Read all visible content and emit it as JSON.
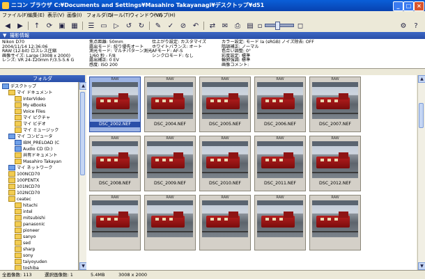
{
  "window": {
    "title": "ニコン ブラウザ C:¥Documents and Settings¥Masahiro Takayanagi¥デスクトップ¥d51"
  },
  "menu": [
    "ファイル(F)",
    "編集(E)",
    "表示(V)",
    "画像(I)",
    "フォルダ(D)",
    "ツール(T)",
    "ウィンドウ(W)",
    "ヘルプ(H)"
  ],
  "info_panel": {
    "header": "撮影情報",
    "col1": [
      "Nikon D70",
      "2004/11/14 12:36:06",
      "RAW (12-bit) ロスレス圧縮",
      "画像サイズ: Large (3008 x 2000)",
      "レンズ: VR 24-120mm F/3.5-5.6 G"
    ],
    "col2": [
      "焦点距離: 50mm",
      "露出モード: 絞り優先オート",
      "測光モード: マルチパターン測光",
      "1/60 秒 - F/8",
      "露出補正: 0 EV",
      "感度: ISO 200"
    ],
    "col3": [
      "仕上がり設定: カスタマイズ",
      "ホワイトバランス: オート",
      "AFモード: AF-S",
      "シンクロモード: なし"
    ],
    "col4": [
      "カラー設定: モード Ia (sRGB)",
      "階調補正: ノーマル",
      "色合い調整: 0°",
      "彩度設定: 標準",
      "輪郭強調: 標準",
      "画像コメント:"
    ],
    "col5": [
      "ノイズ除去: OFF"
    ]
  },
  "folder_panel": {
    "header": "フォルダ",
    "items": [
      {
        "label": "デスクトップ",
        "indent": 0,
        "icon": "desktop-icon"
      },
      {
        "label": "マイ ドキュメント",
        "indent": 1,
        "icon": "folder-icon"
      },
      {
        "label": "InterVideo",
        "indent": 2,
        "icon": "folder-icon"
      },
      {
        "label": "My eBooks",
        "indent": 2,
        "icon": "folder-icon"
      },
      {
        "label": "Voice Files",
        "indent": 2,
        "icon": "folder-icon"
      },
      {
        "label": "マイ ピクチャ",
        "indent": 2,
        "icon": "folder-icon"
      },
      {
        "label": "マイ ビデオ",
        "indent": 2,
        "icon": "folder-icon"
      },
      {
        "label": "マイ ミュージック",
        "indent": 2,
        "icon": "folder-icon"
      },
      {
        "label": "マイ コンピュータ",
        "indent": 1,
        "icon": "computer-icon"
      },
      {
        "label": "IBM_PRELOAD (C",
        "indent": 2,
        "icon": "drive-icon"
      },
      {
        "label": "Audio CD (D:)",
        "indent": 2,
        "icon": "cd-icon"
      },
      {
        "label": "共有ドキュメント",
        "indent": 2,
        "icon": "folder-icon"
      },
      {
        "label": "Masahiro Takayan",
        "indent": 2,
        "icon": "folder-icon"
      },
      {
        "label": "マイ ネットワーク",
        "indent": 1,
        "icon": "network-icon"
      },
      {
        "label": "100NCD70",
        "indent": 1,
        "icon": "folder-icon"
      },
      {
        "label": "100PENTX",
        "indent": 1,
        "icon": "folder-icon"
      },
      {
        "label": "101NCD70",
        "indent": 1,
        "icon": "folder-icon"
      },
      {
        "label": "102NCD70",
        "indent": 1,
        "icon": "folder-icon"
      },
      {
        "label": "ceatec",
        "indent": 1,
        "icon": "folder-icon"
      },
      {
        "label": "hitachi",
        "indent": 2,
        "icon": "folder-icon"
      },
      {
        "label": "intel",
        "indent": 2,
        "icon": "folder-icon"
      },
      {
        "label": "mitsubishi",
        "indent": 2,
        "icon": "folder-icon"
      },
      {
        "label": "panasonic",
        "indent": 2,
        "icon": "folder-icon"
      },
      {
        "label": "pioneer",
        "indent": 2,
        "icon": "folder-icon"
      },
      {
        "label": "sanyo",
        "indent": 2,
        "icon": "folder-icon"
      },
      {
        "label": "sed",
        "indent": 2,
        "icon": "folder-icon"
      },
      {
        "label": "sharp",
        "indent": 2,
        "icon": "folder-icon"
      },
      {
        "label": "sony",
        "indent": 2,
        "icon": "folder-icon"
      },
      {
        "label": "taiyoyuden",
        "indent": 2,
        "icon": "folder-icon"
      },
      {
        "label": "toshiba",
        "indent": 2,
        "icon": "folder-icon"
      }
    ]
  },
  "thumbnails": {
    "badge": "RAW",
    "rows": [
      [
        "DSC_2002.NEF",
        "DSC_2004.NEF",
        "DSC_2005.NEF",
        "DSC_2006.NEF",
        "DSC_2007.NEF"
      ],
      [
        "DSC_2008.NEF",
        "DSC_2009.NEF",
        "DSC_2010.NEF",
        "DSC_2011.NEF",
        "DSC_2012.NEF"
      ],
      [
        "",
        "",
        "",
        "",
        ""
      ]
    ],
    "selected": "DSC_2002.NEF"
  },
  "status": {
    "total": "全画像数: 113",
    "selected": "選択画像数: 1",
    "size": "5.4MB",
    "dimensions": "3008 x 2000"
  },
  "colors": {
    "title_bar": "#0a5fd8",
    "panel_header": "#2a4fa8",
    "selection": "#2a4fa8",
    "window_bg": "#ece9d8"
  }
}
